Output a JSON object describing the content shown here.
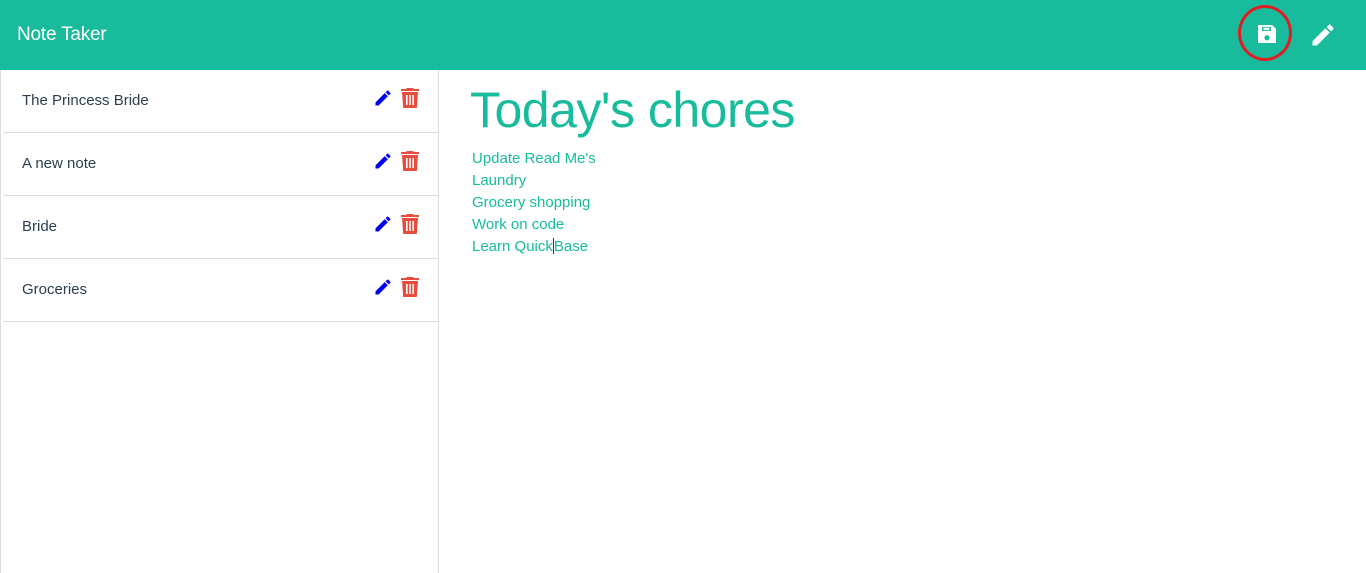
{
  "navbar": {
    "brand": "Note Taker",
    "save_icon": "save-icon",
    "new_icon": "pencil-icon",
    "bg_color": "#18bc9c"
  },
  "notes": [
    {
      "title": "The Princess Bride"
    },
    {
      "title": "A new note"
    },
    {
      "title": "Bride"
    },
    {
      "title": "Groceries"
    }
  ],
  "note_actions": {
    "edit_icon": "pencil-icon",
    "delete_icon": "trash-icon",
    "edit_color": "#0000ee",
    "delete_color": "#e74c3c"
  },
  "active_note": {
    "title": "Today's chores",
    "lines": [
      "Update Read Me's",
      "Laundry",
      "Grocery shopping",
      "Work on code",
      "Learn Quick",
      "Base"
    ]
  }
}
